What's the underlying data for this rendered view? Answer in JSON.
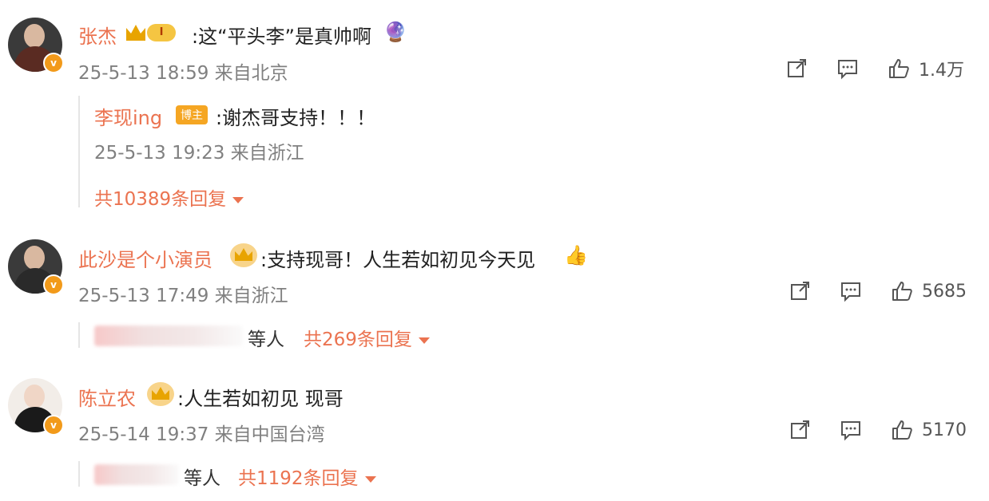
{
  "comments": [
    {
      "user": "张杰",
      "level": "I",
      "text": ":这“平头李”是真帅啊",
      "emoji": "🔮",
      "time": "25-5-13 18:59 来自北京",
      "likes": "1.4万",
      "reply": {
        "user": "李现ing",
        "badge": "博主",
        "text": ":谢杰哥支持！！！",
        "time": "25-5-13 19:23 来自浙江"
      },
      "more": "共10389条回复"
    },
    {
      "user": "此沙是个小演员",
      "text": ":支持现哥！人生若如初见今天见",
      "emoji": "👍",
      "time": "25-5-13 17:49 来自浙江",
      "likes": "5685",
      "etc": "等人",
      "more": "共269条回复"
    },
    {
      "user": "陈立农",
      "text": ":人生若如初见 现哥",
      "time": "25-5-14 19:37 来自中国台湾",
      "likes": "5170",
      "etc": "等人",
      "more": "共1192条回复"
    }
  ],
  "icons": {
    "share": "share-icon",
    "comment": "comment-icon",
    "like": "like-icon"
  },
  "colors": {
    "accent": "#eb7350",
    "verified": "#f29a1a"
  }
}
